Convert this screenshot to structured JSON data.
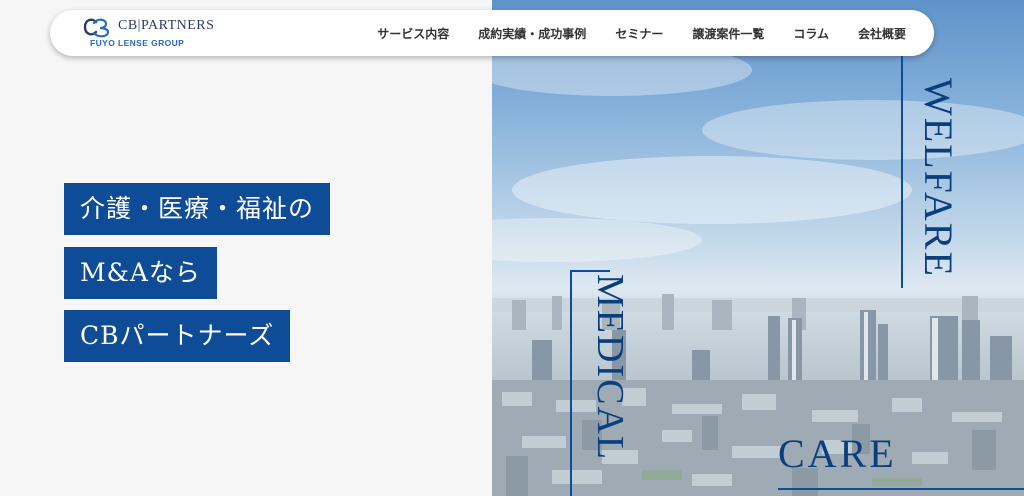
{
  "brand": {
    "name": "CB|PARTNERS",
    "sub": "FUYO LENSE GROUP",
    "primary_color": "#0f4c97",
    "dark_color": "#2d3b60"
  },
  "nav": {
    "items": [
      {
        "label": "サービス内容"
      },
      {
        "label": "成約実績・成功事例"
      },
      {
        "label": "セミナー"
      },
      {
        "label": "譲渡案件一覧"
      },
      {
        "label": "コラム"
      },
      {
        "label": "会社概要"
      }
    ]
  },
  "hero": {
    "lines": [
      "介護・医療・福祉の",
      "M&Aなら",
      "CBパートナーズ"
    ],
    "words": {
      "welfare": "WELFARE",
      "medical": "MEDICAL",
      "care": "CARE"
    }
  }
}
